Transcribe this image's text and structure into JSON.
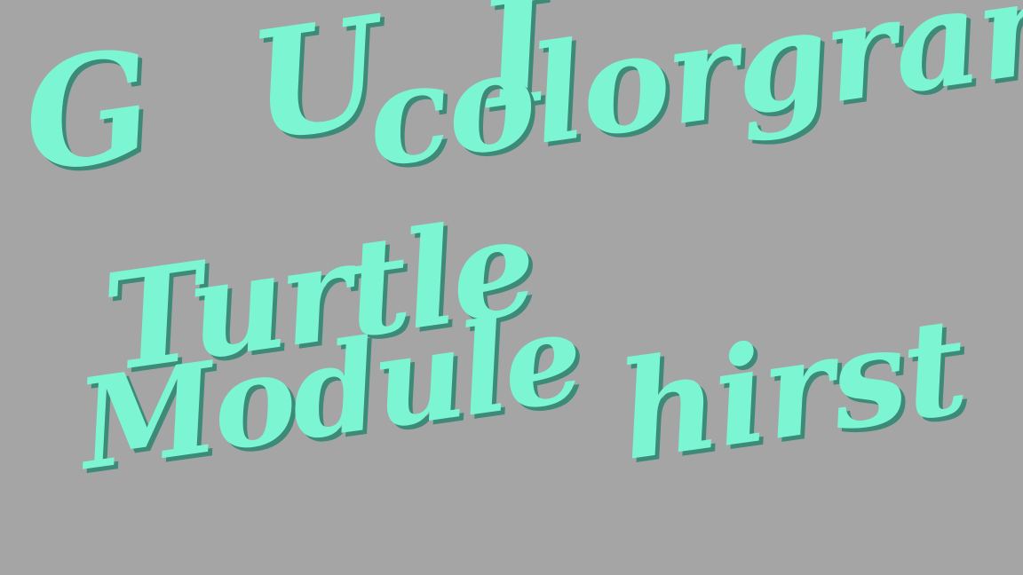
{
  "background_color": "#a5a5a5",
  "text_color": "#7cf5d3",
  "shadow_color": "#3c8a77",
  "words": {
    "gui": "G U I",
    "colorgram": "colorgram",
    "turtle": "Turtle",
    "module": "Module",
    "hirst": "hirst"
  }
}
